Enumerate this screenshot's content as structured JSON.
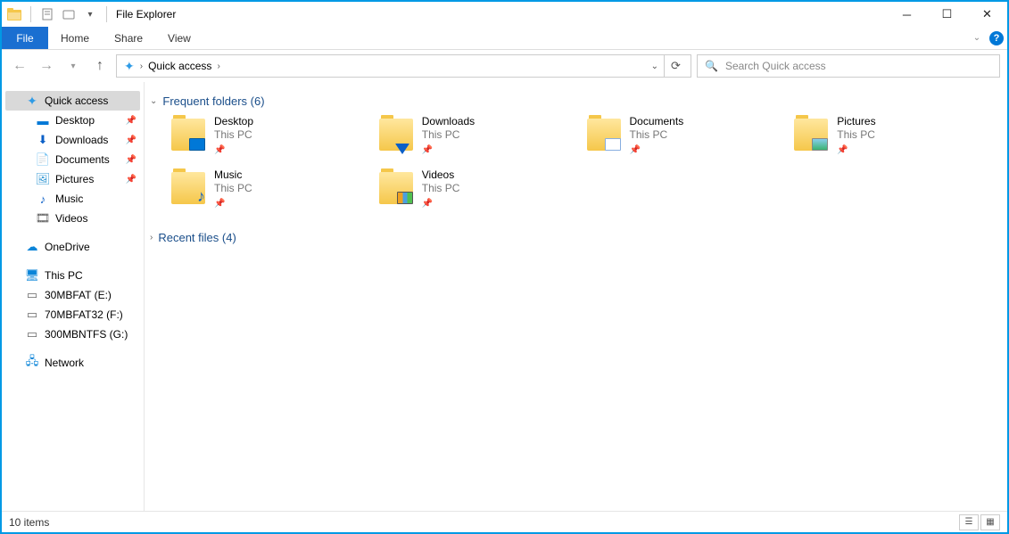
{
  "title": "File Explorer",
  "ribbon": {
    "file": "File",
    "tabs": [
      "Home",
      "Share",
      "View"
    ]
  },
  "nav": {
    "breadcrumb_root_icon": "star",
    "breadcrumb": "Quick access",
    "search_placeholder": "Search Quick access"
  },
  "tree": {
    "quick_access": "Quick access",
    "quick_children": [
      {
        "label": "Desktop",
        "icon": "desktop",
        "pinned": true
      },
      {
        "label": "Downloads",
        "icon": "downloads",
        "pinned": true
      },
      {
        "label": "Documents",
        "icon": "documents",
        "pinned": true
      },
      {
        "label": "Pictures",
        "icon": "pictures",
        "pinned": true
      },
      {
        "label": "Music",
        "icon": "music",
        "pinned": false
      },
      {
        "label": "Videos",
        "icon": "videos",
        "pinned": false
      }
    ],
    "onedrive": "OneDrive",
    "thispc": "This PC",
    "drives": [
      {
        "label": "30MBFAT (E:)"
      },
      {
        "label": "70MBFAT32 (F:)"
      },
      {
        "label": "300MBNTFS (G:)"
      }
    ],
    "network": "Network"
  },
  "groups": {
    "frequent": {
      "label": "Frequent folders",
      "count": 6
    },
    "recent": {
      "label": "Recent files",
      "count": 4
    }
  },
  "folders": [
    {
      "name": "Desktop",
      "loc": "This PC",
      "badge": "desktop"
    },
    {
      "name": "Downloads",
      "loc": "This PC",
      "badge": "down"
    },
    {
      "name": "Documents",
      "loc": "This PC",
      "badge": "doc"
    },
    {
      "name": "Pictures",
      "loc": "This PC",
      "badge": "pic"
    },
    {
      "name": "Music",
      "loc": "This PC",
      "badge": "music"
    },
    {
      "name": "Videos",
      "loc": "This PC",
      "badge": "video"
    }
  ],
  "status": {
    "items": "10 items"
  }
}
